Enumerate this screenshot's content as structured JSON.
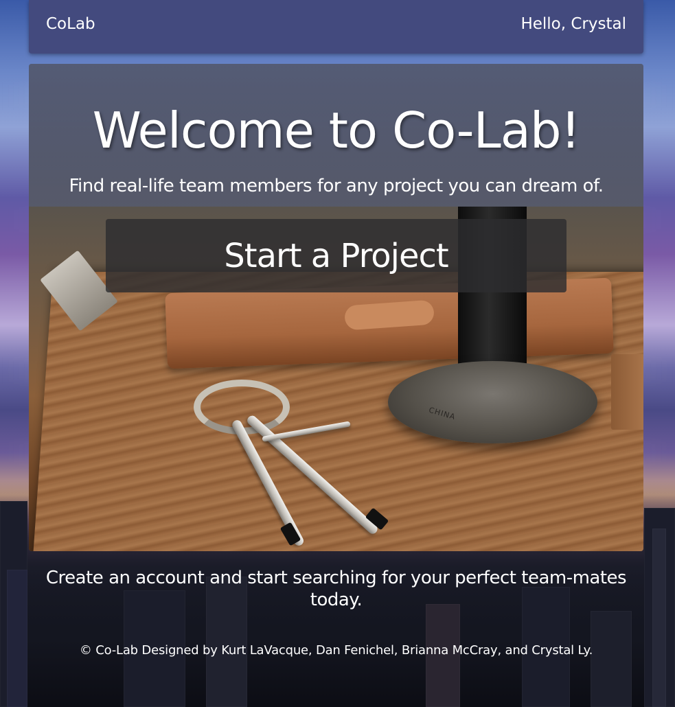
{
  "navbar": {
    "brand": "CoLab",
    "greeting": "Hello, Crystal"
  },
  "hero": {
    "title": "Welcome to Co-Lab!",
    "tagline": "Find real-life team members for any project you can dream of.",
    "cta_label": "Start a Project",
    "photo_caption": "CHINA"
  },
  "footer": {
    "call_to_action": "Create an account and start searching for your perfect team-mates today.",
    "copyright": "© Co-Lab Designed by Kurt LaVacque, Dan Fenichel, Brianna McCray, and Crystal Ly."
  },
  "colors": {
    "navbar": "#434a7e",
    "cta_background": "rgba(45,45,48,0.82)",
    "text": "#ffffff"
  }
}
